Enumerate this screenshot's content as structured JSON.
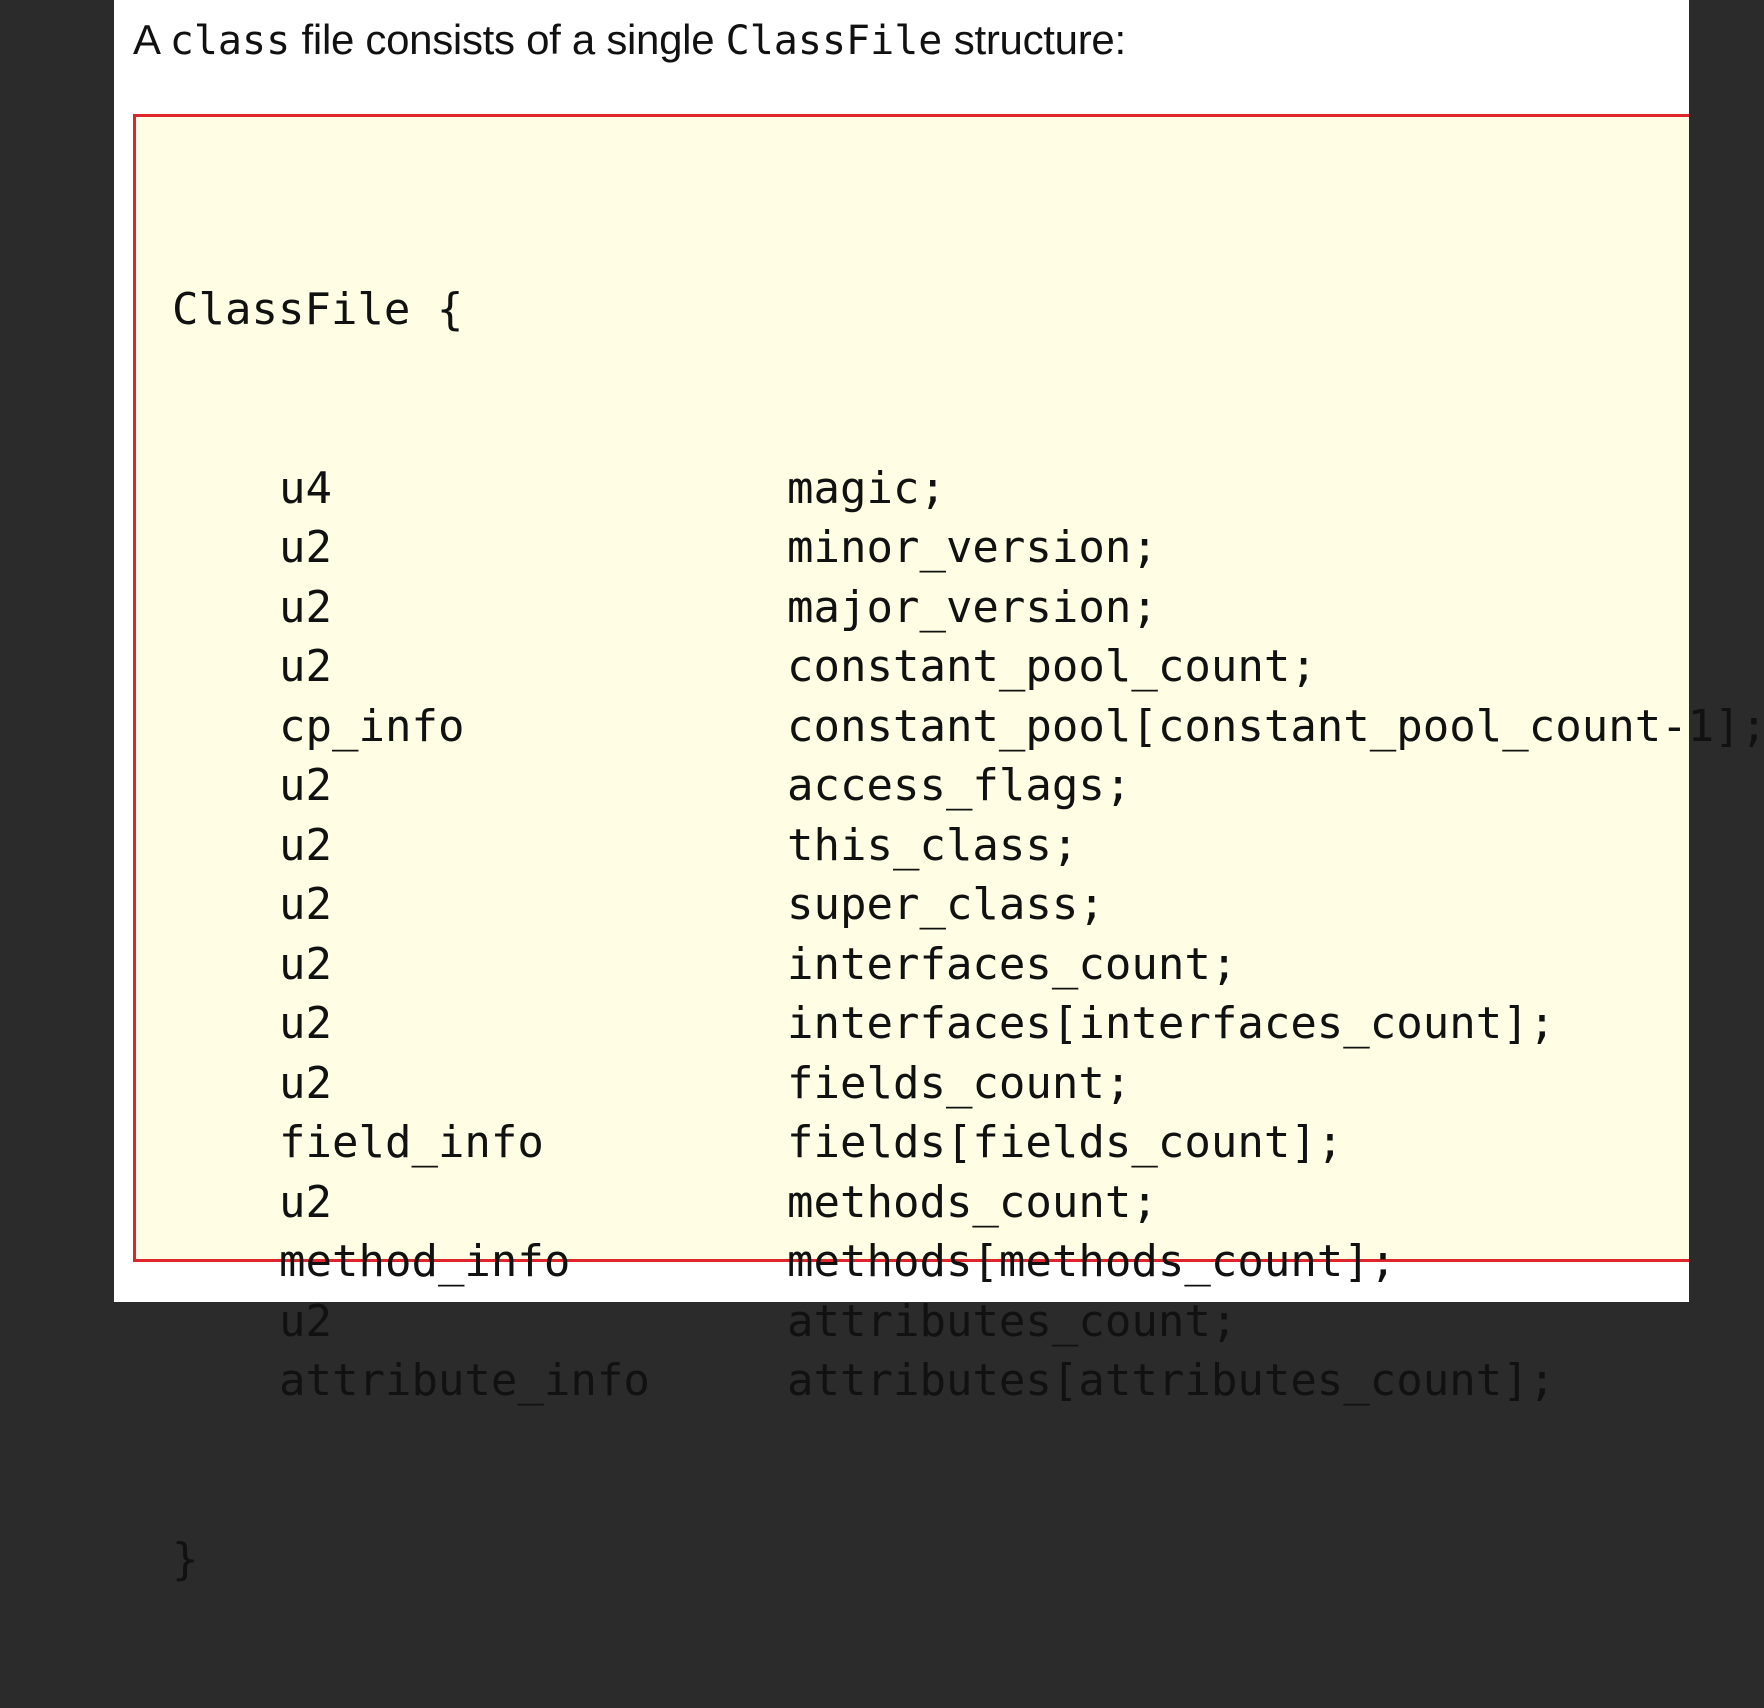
{
  "intro": {
    "prefix": "A ",
    "code1": "class",
    "middle": " file consists of a single ",
    "code2": "ClassFile",
    "suffix": " structure:"
  },
  "code": {
    "open": "ClassFile {",
    "close": "}",
    "fields": [
      {
        "type": "u4",
        "name": "magic;"
      },
      {
        "type": "u2",
        "name": "minor_version;"
      },
      {
        "type": "u2",
        "name": "major_version;"
      },
      {
        "type": "u2",
        "name": "constant_pool_count;"
      },
      {
        "type": "cp_info",
        "name": "constant_pool[constant_pool_count-1];"
      },
      {
        "type": "u2",
        "name": "access_flags;"
      },
      {
        "type": "u2",
        "name": "this_class;"
      },
      {
        "type": "u2",
        "name": "super_class;"
      },
      {
        "type": "u2",
        "name": "interfaces_count;"
      },
      {
        "type": "u2",
        "name": "interfaces[interfaces_count];"
      },
      {
        "type": "u2",
        "name": "fields_count;"
      },
      {
        "type": "field_info",
        "name": "fields[fields_count];"
      },
      {
        "type": "u2",
        "name": "methods_count;"
      },
      {
        "type": "method_info",
        "name": "methods[methods_count];"
      },
      {
        "type": "u2",
        "name": "attributes_count;"
      },
      {
        "type": "attribute_info",
        "name": "attributes[attributes_count];"
      }
    ]
  },
  "colors": {
    "background": "#2b2b2b",
    "page": "#ffffff",
    "code_background": "#fffde3",
    "code_border": "#e0242c"
  }
}
